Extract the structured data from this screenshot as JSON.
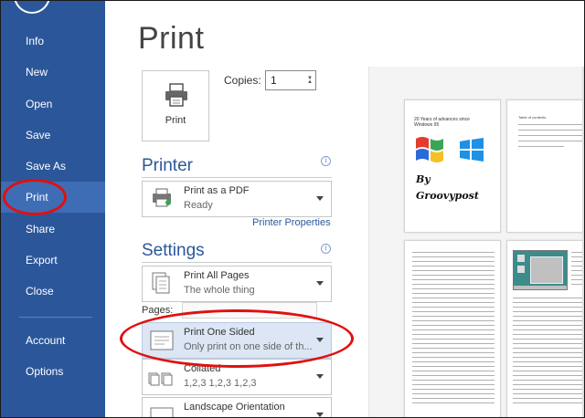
{
  "sidebar": {
    "items": [
      {
        "id": "info",
        "label": "Info"
      },
      {
        "id": "new",
        "label": "New"
      },
      {
        "id": "open",
        "label": "Open"
      },
      {
        "id": "save",
        "label": "Save"
      },
      {
        "id": "save-as",
        "label": "Save As"
      },
      {
        "id": "print",
        "label": "Print"
      },
      {
        "id": "share",
        "label": "Share"
      },
      {
        "id": "export",
        "label": "Export"
      },
      {
        "id": "close",
        "label": "Close"
      }
    ],
    "bottom_items": [
      {
        "id": "account",
        "label": "Account"
      },
      {
        "id": "options",
        "label": "Options"
      }
    ],
    "active": "print"
  },
  "page": {
    "title": "Print"
  },
  "print_button": {
    "label": "Print"
  },
  "copies": {
    "label": "Copies:",
    "value": "1"
  },
  "printer": {
    "heading": "Printer",
    "name": "Print as a PDF",
    "status": "Ready",
    "properties_link": "Printer Properties"
  },
  "settings": {
    "heading": "Settings",
    "print_range": {
      "main": "Print All Pages",
      "sub": "The whole thing"
    },
    "pages_label": "Pages:",
    "sides": {
      "main": "Print One Sided",
      "sub": "Only print on one side of th..."
    },
    "collation": {
      "main": "Collated",
      "sub": "1,2,3    1,2,3    1,2,3"
    },
    "orientation": {
      "main": "Landscape Orientation"
    }
  },
  "preview": {
    "page1": {
      "title": "20 Years of advances since Windows 95",
      "byline_1": "By",
      "byline_2": "Groovypost"
    },
    "page2": {
      "title": "Table of contents"
    }
  },
  "colors": {
    "sidebar": "#2b579a",
    "accent": "#2b579a",
    "highlight": "#dce6f4",
    "annotation": "#e01010"
  }
}
